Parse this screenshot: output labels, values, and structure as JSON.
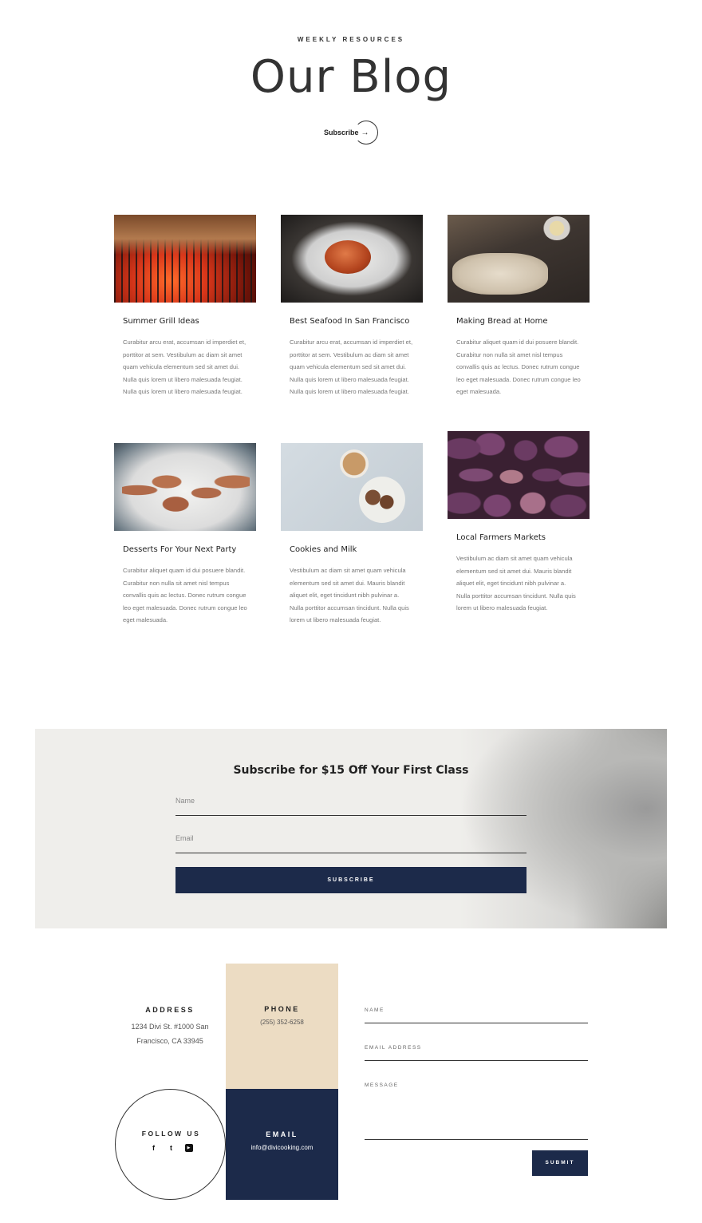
{
  "hero": {
    "eyebrow": "WEEKLY RESOURCES",
    "title": "Our Blog",
    "subscribe_label": "Subscribe",
    "arrow": "→"
  },
  "posts": [
    {
      "title": "Summer Grill Ideas",
      "excerpt": "Curabitur arcu erat, accumsan id imperdiet et, porttitor at sem. Vestibulum ac diam sit amet quam vehicula elementum sed sit amet dui. Nulla quis lorem ut libero malesuada feugiat. Nulla quis lorem ut libero malesuada feugiat."
    },
    {
      "title": "Best Seafood In San Francisco",
      "excerpt": "Curabitur arcu erat, accumsan id imperdiet et, porttitor at sem. Vestibulum ac diam sit amet quam vehicula elementum sed sit amet dui. Nulla quis lorem ut libero malesuada feugiat. Nulla quis lorem ut libero malesuada feugiat."
    },
    {
      "title": "Making Bread at Home",
      "excerpt": "Curabitur aliquet quam id dui posuere blandit. Curabitur non nulla sit amet nisl tempus convallis quis ac lectus. Donec rutrum congue leo eget malesuada. Donec rutrum congue leo eget malesuada."
    },
    {
      "title": "Desserts For Your Next Party",
      "excerpt": "Curabitur aliquet quam id dui posuere blandit. Curabitur non nulla sit amet nisl tempus convallis quis ac lectus. Donec rutrum congue leo eget malesuada. Donec rutrum congue leo eget malesuada."
    },
    {
      "title": "Cookies and Milk",
      "excerpt": "Vestibulum ac diam sit amet quam vehicula elementum sed sit amet dui. Mauris blandit aliquet elit, eget tincidunt nibh pulvinar a. Nulla porttitor accumsan tincidunt. Nulla quis lorem ut libero malesuada feugiat."
    },
    {
      "title": "Local Farmers Markets",
      "excerpt": "Vestibulum ac diam sit amet quam vehicula elementum sed sit amet dui. Mauris blandit aliquet elit, eget tincidunt nibh pulvinar a. Nulla porttitor accumsan tincidunt. Nulla quis lorem ut libero malesuada feugiat."
    }
  ],
  "newsletter": {
    "heading": "Subscribe for $15 Off Your First Class",
    "name_placeholder": "Name",
    "email_placeholder": "Email",
    "button": "SUBSCRIBE",
    "button_color": "#1c2a4a"
  },
  "contact": {
    "address_label": "ADDRESS",
    "address_line1": "1234 Divi St. #1000 San",
    "address_line2": "Francisco, CA 33945",
    "phone_label": "PHONE",
    "phone": "(255) 352-6258",
    "email_label": "EMAIL",
    "email": "info@divicooking.com",
    "follow_label": "FOLLOW US",
    "social": {
      "facebook": "f",
      "twitter": "t",
      "youtube": "▶"
    },
    "form": {
      "name_label": "NAME",
      "email_label": "EMAIL ADDRESS",
      "message_label": "MESSAGE",
      "submit": "SUBMIT"
    },
    "accent_tan": "#ecdcc3",
    "accent_navy": "#1c2a4a"
  }
}
